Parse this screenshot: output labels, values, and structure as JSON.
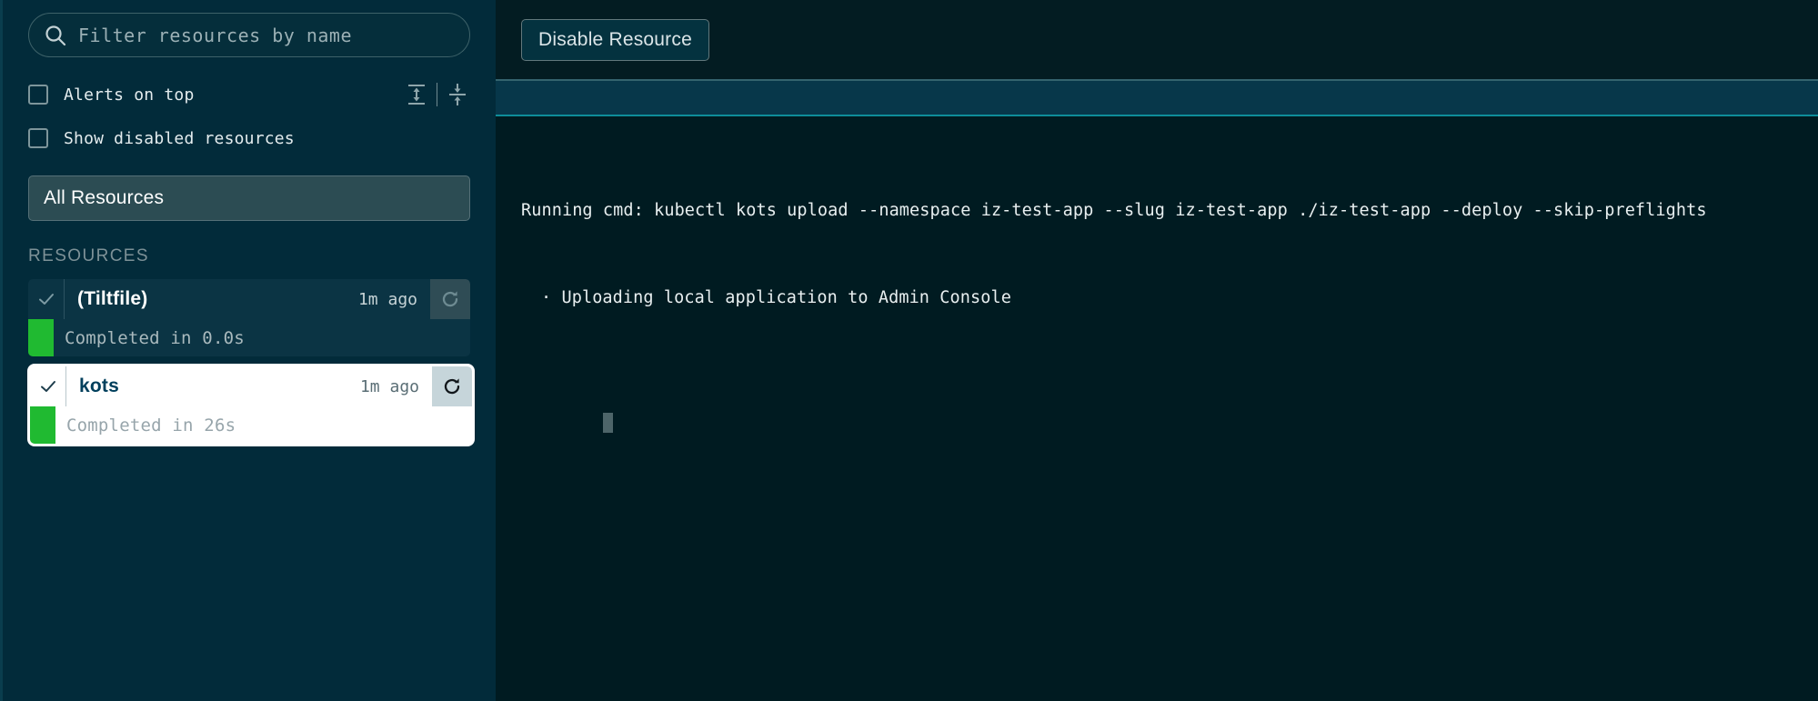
{
  "sidebar": {
    "search": {
      "placeholder": "Filter resources by name",
      "value": "",
      "icon": "search-icon"
    },
    "checkboxes": [
      {
        "label": "Alerts on top",
        "checked": false
      },
      {
        "label": "Show disabled resources",
        "checked": false
      }
    ],
    "sort_controls": [
      {
        "name": "expand-all-icon"
      },
      {
        "name": "collapse-all-icon"
      }
    ],
    "all_resources_label": "All Resources",
    "resources_heading": "RESOURCES",
    "resources": [
      {
        "name": "(Tiltfile)",
        "time": "1m ago",
        "status": "Completed in 0.0s",
        "status_color": "#20ba31",
        "selected": false,
        "trigger_icon": "refresh-icon",
        "check_icon": "check-icon"
      },
      {
        "name": "kots",
        "time": "1m ago",
        "status": "Completed in 26s",
        "status_color": "#20ba31",
        "selected": true,
        "trigger_icon": "refresh-icon",
        "check_icon": "check-icon"
      }
    ]
  },
  "main": {
    "disable_button_label": "Disable Resource",
    "log_lines": [
      "Running cmd: kubectl kots upload --namespace iz-test-app --slug iz-test-app ./iz-test-app --deploy --skip-preflights",
      "· Uploading local application to Admin Console"
    ]
  },
  "colors": {
    "sidebar_bg": "#022b3a",
    "main_bg": "#001b21",
    "accent_green": "#20ba31",
    "band_bg": "#07374a",
    "band_border": "#0e8d9a",
    "selected_bg": "#ffffff"
  }
}
